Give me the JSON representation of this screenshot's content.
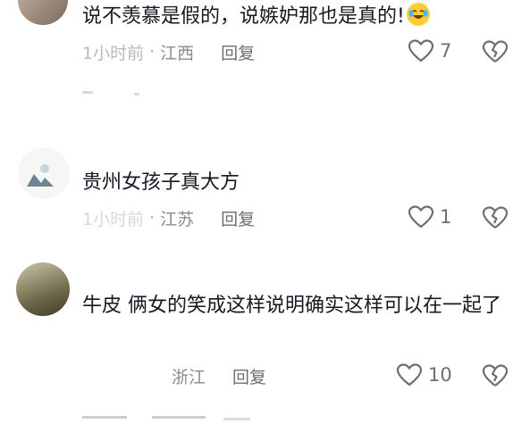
{
  "comments": [
    {
      "text": "说不羡慕是假的，说嫉妒那也是真的!",
      "time": "1小时前",
      "location": "江西",
      "reply_label": "回复",
      "likes": "7",
      "emoji": "laughing-tears-icon"
    },
    {
      "text": "贵州女孩子真大方",
      "time": "1小时前",
      "location": "江苏",
      "reply_label": "回复",
      "likes": "1"
    },
    {
      "text": "牛皮 俩女的笑成这样说明确实这样可以在一起了",
      "time": "",
      "location": "浙江",
      "reply_label": "回复",
      "likes": "10"
    }
  ],
  "colors": {
    "text": "#161823",
    "meta": "#8a8b91",
    "background": "#ffffff"
  }
}
